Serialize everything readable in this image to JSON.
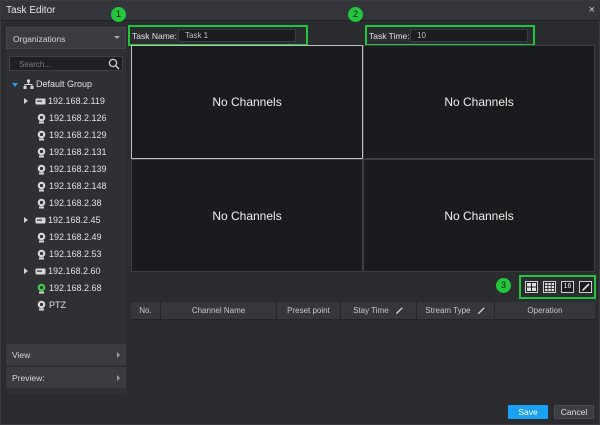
{
  "window": {
    "title": "Task Editor",
    "close_glyph": "×"
  },
  "left_panel": {
    "dropdown_label": "Organizations",
    "search_placeholder": "Search...",
    "tree": [
      {
        "label": "Default Group",
        "icon": "group-icon",
        "expanded": true
      },
      {
        "label": "192.168.2.119",
        "icon": "nvr-icon",
        "collapsed": true
      },
      {
        "label": "192.168.2.126",
        "icon": "camera-icon"
      },
      {
        "label": "192.168.2.129",
        "icon": "camera-icon"
      },
      {
        "label": "192.168.2.131",
        "icon": "camera-icon"
      },
      {
        "label": "192.168.2.139",
        "icon": "camera-icon"
      },
      {
        "label": "192.168.2.148",
        "icon": "camera-icon"
      },
      {
        "label": "192.168.2.38",
        "icon": "camera-icon"
      },
      {
        "label": "192.168.2.45",
        "icon": "nvr-icon",
        "collapsed": true
      },
      {
        "label": "192.168.2.49",
        "icon": "camera-icon"
      },
      {
        "label": "192.168.2.53",
        "icon": "camera-icon"
      },
      {
        "label": "192.168.2.60",
        "icon": "nvr-icon",
        "collapsed": true
      },
      {
        "label": "192.168.2.68",
        "icon": "camera-icon-green"
      },
      {
        "label": "PTZ",
        "icon": "ptz-icon"
      }
    ],
    "view_label": "View",
    "preview_label": "Preview:"
  },
  "task": {
    "name_label": "Task Name:",
    "name_value": "Task 1",
    "time_label": "Task Time:",
    "time_value": "10"
  },
  "badges": [
    "1",
    "2",
    "3"
  ],
  "channels": [
    "No Channels",
    "No Channels",
    "No Channels",
    "No Channels"
  ],
  "layout_buttons": {
    "quad": "2x2-layout-icon",
    "nine": "3x3-layout-icon",
    "sixteen": "16",
    "edit": "pencil-icon"
  },
  "table": {
    "columns": [
      "No.",
      "Channel Name",
      "Preset point",
      "Stay Time",
      "Stream Type",
      "Operation"
    ]
  },
  "buttons": {
    "save": "Save",
    "cancel": "Cancel"
  },
  "colors": {
    "accent_green": "#22c53c",
    "save_blue": "#1aa0f0",
    "tree_blue": "#2a9be6"
  }
}
